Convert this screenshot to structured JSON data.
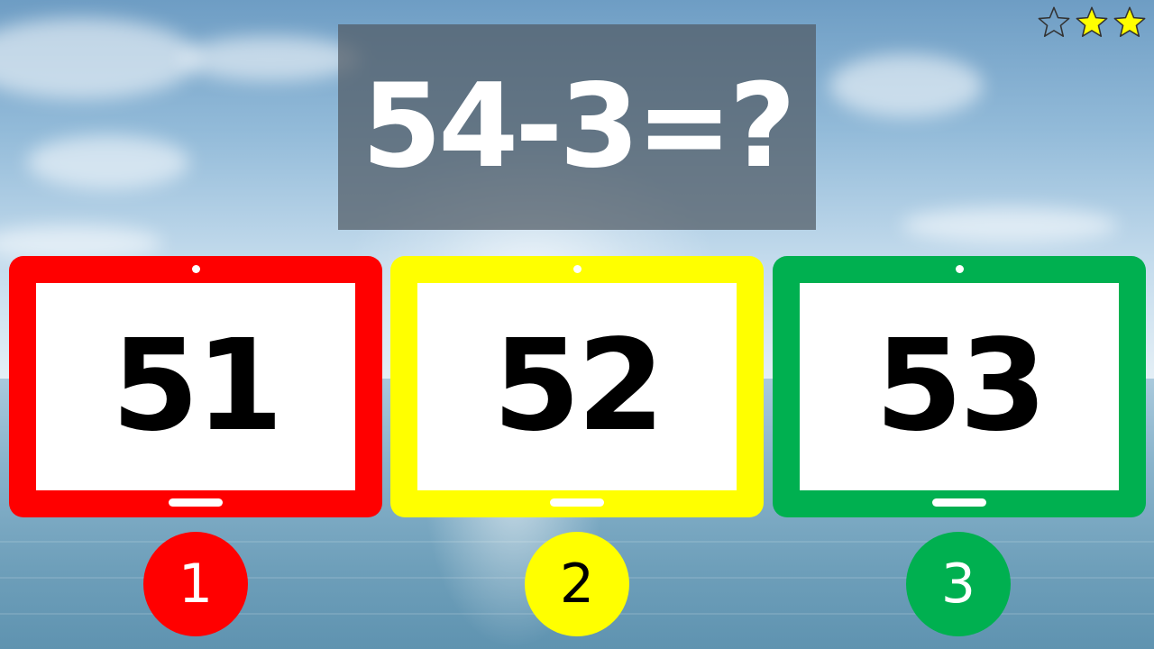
{
  "question": {
    "text": "54-3=?"
  },
  "rating": {
    "stars": [
      {
        "icon": "star-outline-icon",
        "filled": false
      },
      {
        "icon": "star-filled-icon",
        "filled": true
      },
      {
        "icon": "star-filled-icon",
        "filled": true
      }
    ],
    "filled_color": "#ffff00"
  },
  "answers": [
    {
      "value": "51",
      "number": "1",
      "color": "#ff0000",
      "number_color": "#ffffff"
    },
    {
      "value": "52",
      "number": "2",
      "color": "#ffff00",
      "number_color": "#000000"
    },
    {
      "value": "53",
      "number": "3",
      "color": "#00b050",
      "number_color": "#ffffff"
    }
  ]
}
